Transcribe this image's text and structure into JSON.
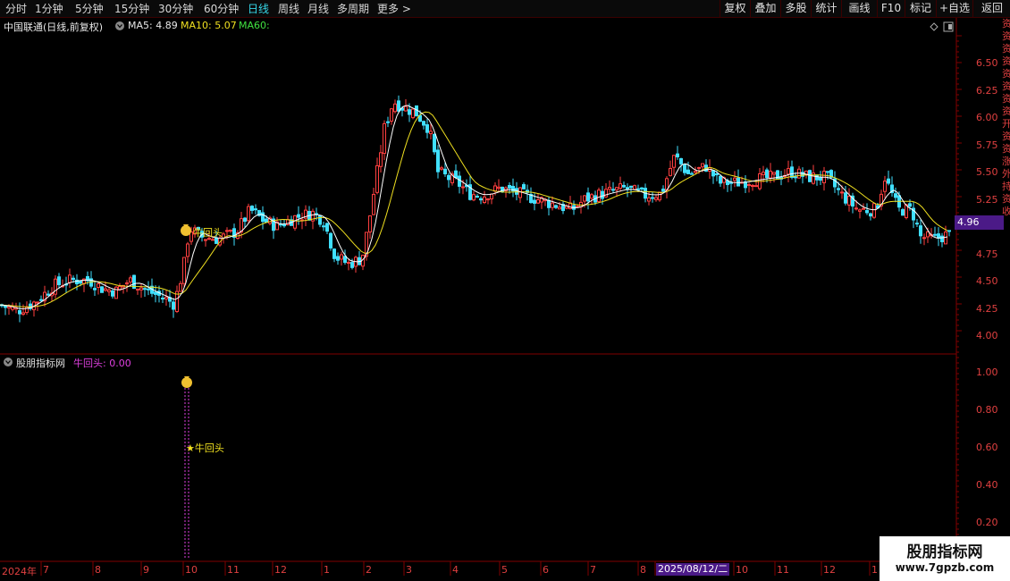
{
  "toolbar": {
    "periods": [
      "分时",
      "1分钟",
      "5分钟",
      "15分钟",
      "30分钟",
      "60分钟",
      "日线",
      "周线",
      "月线",
      "多周期",
      "更多 >"
    ],
    "active_period": "日线",
    "right_buttons": [
      "复权",
      "叠加",
      "多股",
      "统计",
      "画线",
      "F10",
      "标记",
      "+自选",
      "返回"
    ]
  },
  "stock": {
    "title": "中国联通(日线,前复权)",
    "ma5": "MA5: 4.89",
    "ma10": "MA10: 5.07",
    "ma60": "MA60:",
    "current_price": "4.96",
    "price_labels": [
      "6.50",
      "6.25",
      "6.00",
      "5.75",
      "5.50",
      "5.25",
      "4.75",
      "4.50",
      "4.25",
      "4.00"
    ],
    "signal_label": "牛回头"
  },
  "indicator": {
    "title": "股朋指标网",
    "value": "牛回头: 0.00",
    "labels": [
      "1.00",
      "0.80",
      "0.60",
      "0.40",
      "0.20"
    ],
    "signal_label": "★牛回头"
  },
  "x_axis": {
    "labels": [
      "2024年",
      "7",
      "8",
      "9",
      "10",
      "11",
      "12",
      "1",
      "2",
      "3",
      "4",
      "5",
      "6",
      "7",
      "8",
      "10",
      "11",
      "12",
      "1"
    ],
    "cursor_date": "2025/08/12/二"
  },
  "watermark": {
    "line1": "股朋指标网",
    "line2": "www.7gpzb.com"
  },
  "right_strip_text": "资资资资资资资资开资资涨外持资收",
  "colors": {
    "up": "#ff4040",
    "down": "#40e0ff",
    "ma5": "#ffffff",
    "ma10": "#f0e020",
    "active": "#36d7e8",
    "signal": "#e040e0",
    "axis": "#e04040",
    "badge": "#4b1a87"
  },
  "icons": {
    "dropdown": "chevron-circle-icon",
    "money_bag": "money-bag-icon",
    "star": "star-icon"
  }
}
